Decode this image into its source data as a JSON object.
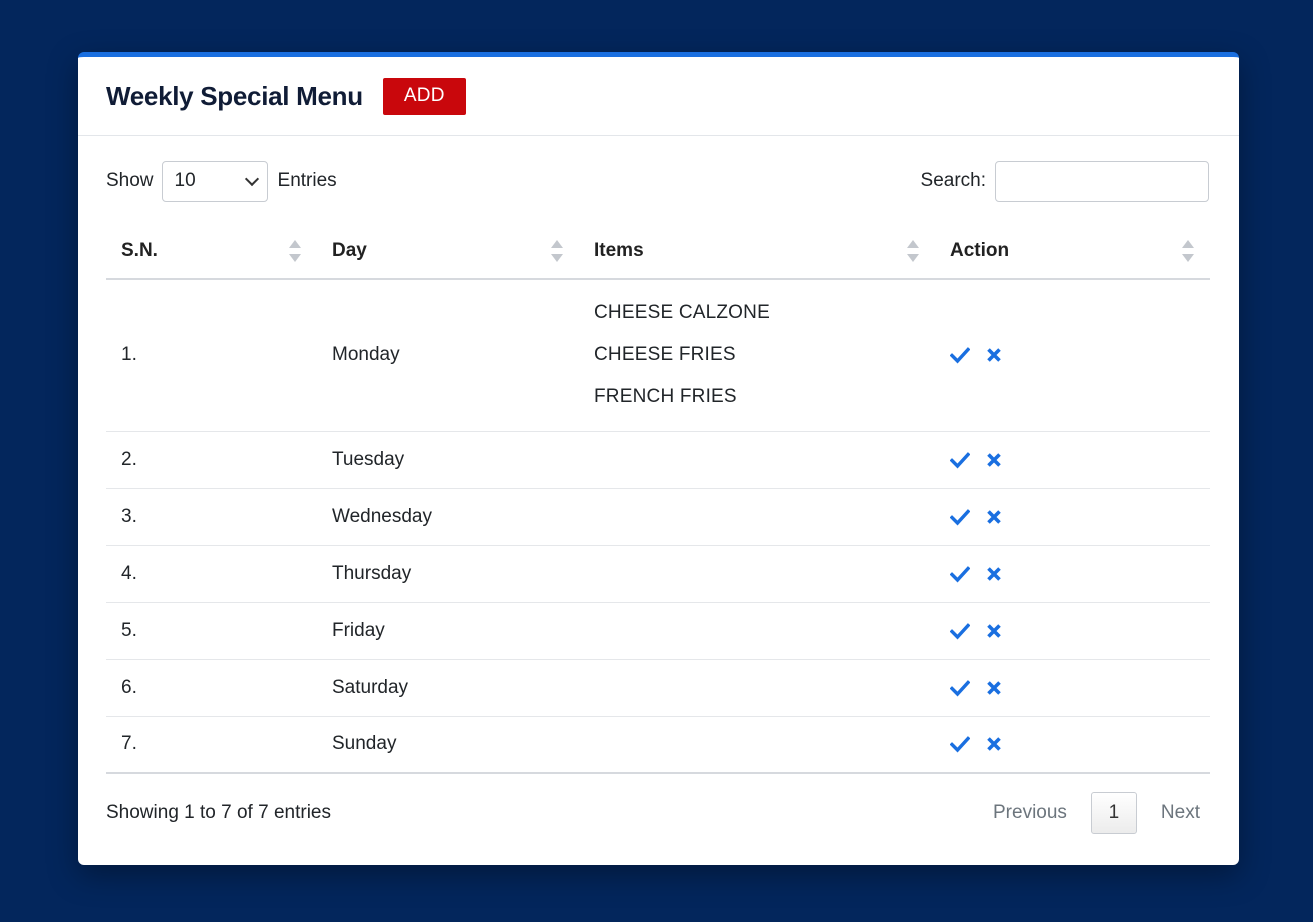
{
  "header": {
    "title": "Weekly Special Menu",
    "add_label": "ADD"
  },
  "controls": {
    "show_label": "Show",
    "entries_value": "10",
    "entries_label": "Entries",
    "search_label": "Search:",
    "search_value": ""
  },
  "table": {
    "columns": [
      "S.N.",
      "Day",
      "Items",
      "Action"
    ],
    "rows": [
      {
        "sn": "1.",
        "day": "Monday",
        "items": [
          "CHEESE CALZONE",
          "CHEESE FRIES",
          "FRENCH FRIES"
        ]
      },
      {
        "sn": "2.",
        "day": "Tuesday",
        "items": []
      },
      {
        "sn": "3.",
        "day": "Wednesday",
        "items": []
      },
      {
        "sn": "4.",
        "day": "Thursday",
        "items": []
      },
      {
        "sn": "5.",
        "day": "Friday",
        "items": []
      },
      {
        "sn": "6.",
        "day": "Saturday",
        "items": []
      },
      {
        "sn": "7.",
        "day": "Sunday",
        "items": []
      }
    ],
    "action_icons": [
      "check-icon",
      "close-icon"
    ]
  },
  "footer": {
    "info": "Showing 1 to 7 of 7 entries",
    "previous_label": "Previous",
    "current_page": "1",
    "next_label": "Next"
  },
  "colors": {
    "background": "#03265c",
    "accent": "#1a6fe0",
    "add_button": "#c9070c",
    "action_icon": "#1a6fe0"
  }
}
